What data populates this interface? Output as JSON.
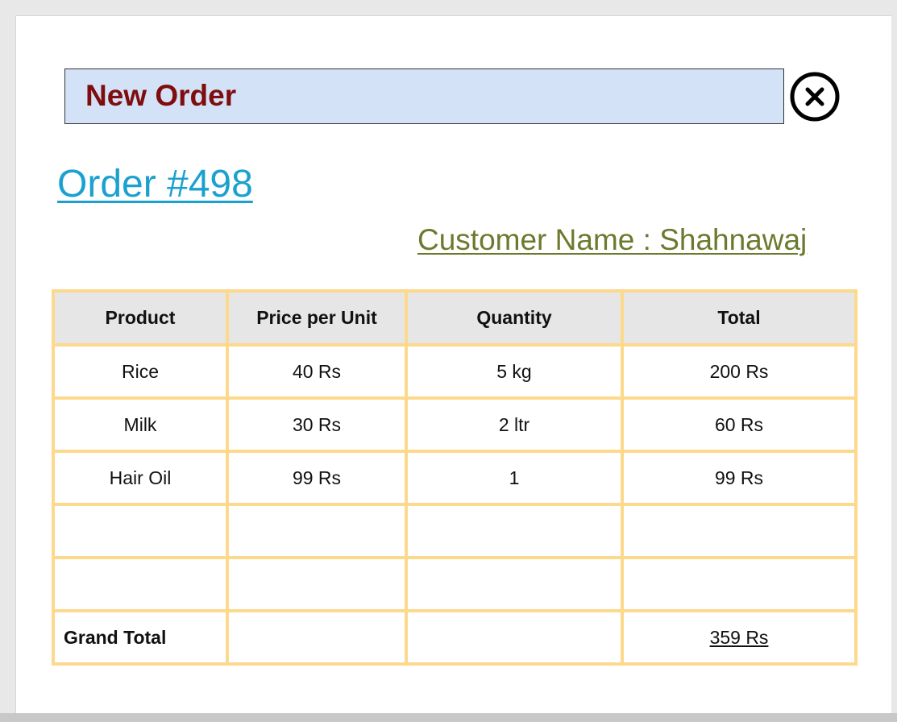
{
  "header": {
    "title": "New Order"
  },
  "order": {
    "number_label": "Order #498",
    "customer_label": "Customer Name : Shahnawaj"
  },
  "table": {
    "columns": [
      "Product",
      "Price per Unit",
      "Quantity",
      "Total"
    ],
    "rows": [
      [
        "Rice",
        "40 Rs",
        "5 kg",
        "200 Rs"
      ],
      [
        "Milk",
        "30 Rs",
        "2 ltr",
        "60 Rs"
      ],
      [
        "Hair Oil",
        "99 Rs",
        "1",
        "99 Rs"
      ],
      [
        "",
        "",
        "",
        ""
      ],
      [
        "",
        "",
        "",
        ""
      ]
    ],
    "footer": {
      "label": "Grand Total",
      "value": "359 Rs"
    }
  },
  "icons": {
    "close": "close-circle-icon"
  },
  "colors": {
    "title_bar_bg": "#d4e2f8",
    "title_text": "#7f0d0d",
    "order_link": "#1ba1cf",
    "customer_text": "#6b7a2e",
    "table_border": "#fcd98c",
    "header_bg": "#e6e6e6"
  }
}
